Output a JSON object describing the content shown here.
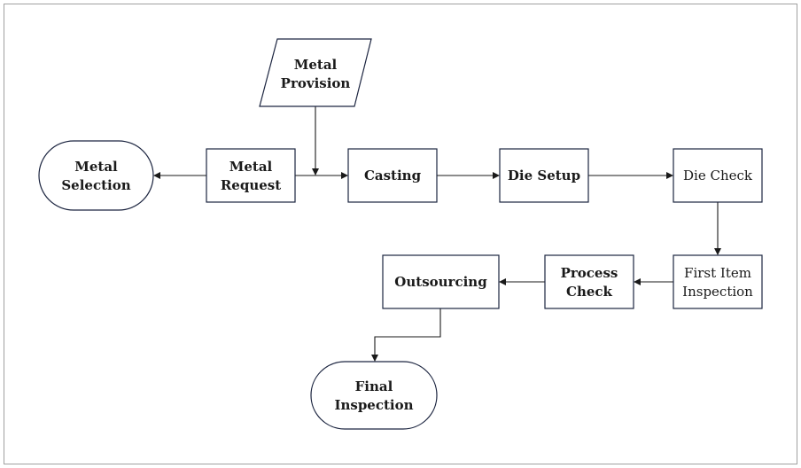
{
  "nodes": {
    "metal_provision": {
      "line1": "Metal",
      "line2": "Provision",
      "shape": "parallelogram"
    },
    "metal_selection": {
      "line1": "Metal",
      "line2": "Selection",
      "shape": "terminator"
    },
    "metal_request": {
      "line1": "Metal",
      "line2": "Request",
      "shape": "process"
    },
    "casting": {
      "line1": "Casting",
      "shape": "process"
    },
    "die_setup": {
      "line1": "Die Setup",
      "shape": "process"
    },
    "die_check": {
      "line1": "Die Check",
      "shape": "process"
    },
    "first_item_inspection": {
      "line1": "First Item",
      "line2": "Inspection",
      "shape": "process"
    },
    "process_check": {
      "line1": "Process",
      "line2": "Check",
      "shape": "process"
    },
    "outsourcing": {
      "line1": "Outsourcing",
      "shape": "process"
    },
    "final_inspection": {
      "line1": "Final",
      "line2": "Inspection",
      "shape": "terminator"
    }
  },
  "edges": [
    {
      "from": "metal_request",
      "to": "metal_selection"
    },
    {
      "from": "metal_request",
      "to": "casting"
    },
    {
      "from": "metal_provision",
      "to": "casting"
    },
    {
      "from": "casting",
      "to": "die_setup"
    },
    {
      "from": "die_setup",
      "to": "die_check"
    },
    {
      "from": "die_check",
      "to": "first_item_inspection"
    },
    {
      "from": "first_item_inspection",
      "to": "process_check"
    },
    {
      "from": "process_check",
      "to": "outsourcing"
    },
    {
      "from": "outsourcing",
      "to": "final_inspection"
    }
  ],
  "colors": {
    "stroke": "#1c2540",
    "frame": "#a0a0a0"
  }
}
